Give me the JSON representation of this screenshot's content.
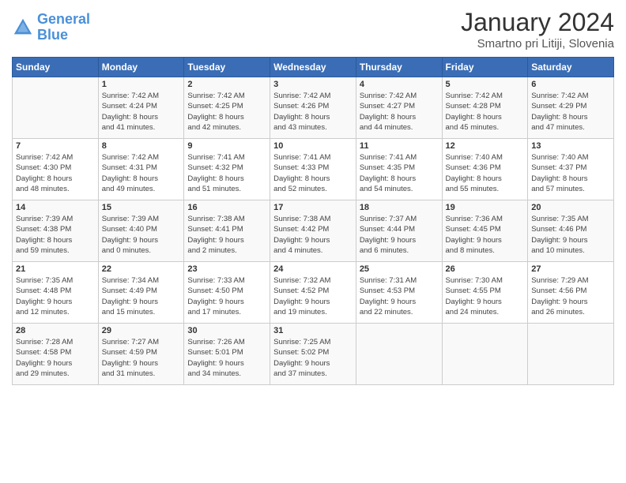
{
  "header": {
    "logo_line1": "General",
    "logo_line2": "Blue",
    "title": "January 2024",
    "location": "Smartno pri Litiji, Slovenia"
  },
  "columns": [
    "Sunday",
    "Monday",
    "Tuesday",
    "Wednesday",
    "Thursday",
    "Friday",
    "Saturday"
  ],
  "weeks": [
    [
      {
        "day": "",
        "info": ""
      },
      {
        "day": "1",
        "info": "Sunrise: 7:42 AM\nSunset: 4:24 PM\nDaylight: 8 hours\nand 41 minutes."
      },
      {
        "day": "2",
        "info": "Sunrise: 7:42 AM\nSunset: 4:25 PM\nDaylight: 8 hours\nand 42 minutes."
      },
      {
        "day": "3",
        "info": "Sunrise: 7:42 AM\nSunset: 4:26 PM\nDaylight: 8 hours\nand 43 minutes."
      },
      {
        "day": "4",
        "info": "Sunrise: 7:42 AM\nSunset: 4:27 PM\nDaylight: 8 hours\nand 44 minutes."
      },
      {
        "day": "5",
        "info": "Sunrise: 7:42 AM\nSunset: 4:28 PM\nDaylight: 8 hours\nand 45 minutes."
      },
      {
        "day": "6",
        "info": "Sunrise: 7:42 AM\nSunset: 4:29 PM\nDaylight: 8 hours\nand 47 minutes."
      }
    ],
    [
      {
        "day": "7",
        "info": "Sunrise: 7:42 AM\nSunset: 4:30 PM\nDaylight: 8 hours\nand 48 minutes."
      },
      {
        "day": "8",
        "info": "Sunrise: 7:42 AM\nSunset: 4:31 PM\nDaylight: 8 hours\nand 49 minutes."
      },
      {
        "day": "9",
        "info": "Sunrise: 7:41 AM\nSunset: 4:32 PM\nDaylight: 8 hours\nand 51 minutes."
      },
      {
        "day": "10",
        "info": "Sunrise: 7:41 AM\nSunset: 4:33 PM\nDaylight: 8 hours\nand 52 minutes."
      },
      {
        "day": "11",
        "info": "Sunrise: 7:41 AM\nSunset: 4:35 PM\nDaylight: 8 hours\nand 54 minutes."
      },
      {
        "day": "12",
        "info": "Sunrise: 7:40 AM\nSunset: 4:36 PM\nDaylight: 8 hours\nand 55 minutes."
      },
      {
        "day": "13",
        "info": "Sunrise: 7:40 AM\nSunset: 4:37 PM\nDaylight: 8 hours\nand 57 minutes."
      }
    ],
    [
      {
        "day": "14",
        "info": "Sunrise: 7:39 AM\nSunset: 4:38 PM\nDaylight: 8 hours\nand 59 minutes."
      },
      {
        "day": "15",
        "info": "Sunrise: 7:39 AM\nSunset: 4:40 PM\nDaylight: 9 hours\nand 0 minutes."
      },
      {
        "day": "16",
        "info": "Sunrise: 7:38 AM\nSunset: 4:41 PM\nDaylight: 9 hours\nand 2 minutes."
      },
      {
        "day": "17",
        "info": "Sunrise: 7:38 AM\nSunset: 4:42 PM\nDaylight: 9 hours\nand 4 minutes."
      },
      {
        "day": "18",
        "info": "Sunrise: 7:37 AM\nSunset: 4:44 PM\nDaylight: 9 hours\nand 6 minutes."
      },
      {
        "day": "19",
        "info": "Sunrise: 7:36 AM\nSunset: 4:45 PM\nDaylight: 9 hours\nand 8 minutes."
      },
      {
        "day": "20",
        "info": "Sunrise: 7:35 AM\nSunset: 4:46 PM\nDaylight: 9 hours\nand 10 minutes."
      }
    ],
    [
      {
        "day": "21",
        "info": "Sunrise: 7:35 AM\nSunset: 4:48 PM\nDaylight: 9 hours\nand 12 minutes."
      },
      {
        "day": "22",
        "info": "Sunrise: 7:34 AM\nSunset: 4:49 PM\nDaylight: 9 hours\nand 15 minutes."
      },
      {
        "day": "23",
        "info": "Sunrise: 7:33 AM\nSunset: 4:50 PM\nDaylight: 9 hours\nand 17 minutes."
      },
      {
        "day": "24",
        "info": "Sunrise: 7:32 AM\nSunset: 4:52 PM\nDaylight: 9 hours\nand 19 minutes."
      },
      {
        "day": "25",
        "info": "Sunrise: 7:31 AM\nSunset: 4:53 PM\nDaylight: 9 hours\nand 22 minutes."
      },
      {
        "day": "26",
        "info": "Sunrise: 7:30 AM\nSunset: 4:55 PM\nDaylight: 9 hours\nand 24 minutes."
      },
      {
        "day": "27",
        "info": "Sunrise: 7:29 AM\nSunset: 4:56 PM\nDaylight: 9 hours\nand 26 minutes."
      }
    ],
    [
      {
        "day": "28",
        "info": "Sunrise: 7:28 AM\nSunset: 4:58 PM\nDaylight: 9 hours\nand 29 minutes."
      },
      {
        "day": "29",
        "info": "Sunrise: 7:27 AM\nSunset: 4:59 PM\nDaylight: 9 hours\nand 31 minutes."
      },
      {
        "day": "30",
        "info": "Sunrise: 7:26 AM\nSunset: 5:01 PM\nDaylight: 9 hours\nand 34 minutes."
      },
      {
        "day": "31",
        "info": "Sunrise: 7:25 AM\nSunset: 5:02 PM\nDaylight: 9 hours\nand 37 minutes."
      },
      {
        "day": "",
        "info": ""
      },
      {
        "day": "",
        "info": ""
      },
      {
        "day": "",
        "info": ""
      }
    ]
  ]
}
